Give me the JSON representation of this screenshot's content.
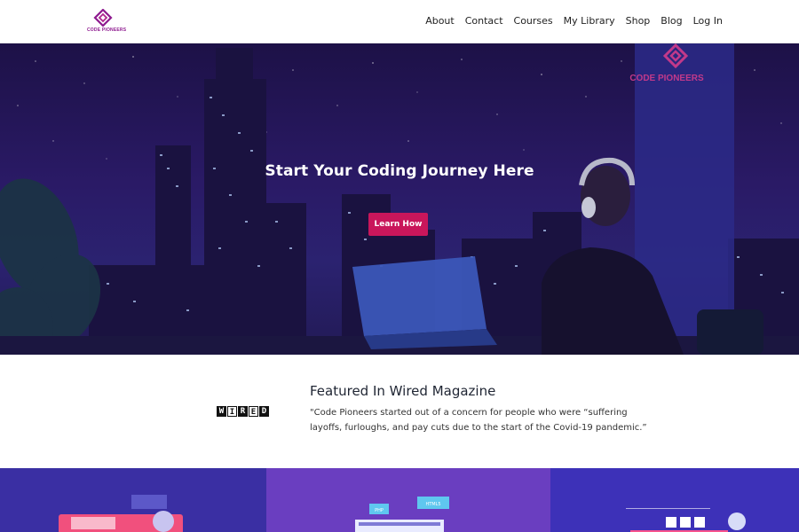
{
  "logo": {
    "text": "CODE PIONEERS",
    "color": "#8e1a8f"
  },
  "nav": {
    "items": [
      "About",
      "Contact",
      "Courses",
      "My Library",
      "Shop",
      "Blog",
      "Log In"
    ]
  },
  "hero": {
    "title": "Start Your Coding Journey Here",
    "button_label": "Learn How",
    "button_color": "#c9165b",
    "sign_text": "CODE PIONEERS"
  },
  "featured": {
    "publication_logo": [
      "W",
      "I",
      "R",
      "E",
      "D"
    ],
    "title": "Featured In Wired Magazine",
    "quote": "\"Code Pioneers started out of a concern for people who were “suffering layoffs, furloughs, and pay cuts due to the start of the Covid-19 pandemic.”"
  },
  "panels": {
    "colors": [
      "#3a2fa3",
      "#6a3ec0",
      "#3d31b8"
    ],
    "tags": [
      "PHP",
      "HTML5"
    ]
  }
}
